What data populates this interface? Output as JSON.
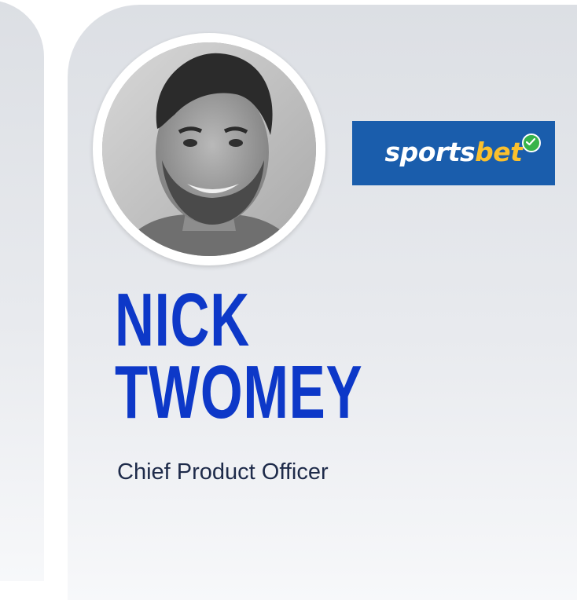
{
  "speaker": {
    "first_name": "NICK",
    "last_name": "TWOMEY",
    "role": "Chief Product Officer",
    "photo_description": "speaker-headshot"
  },
  "company": {
    "logo_part1": "sports",
    "logo_part2": "bet",
    "logo_background": "#1a5dac",
    "logo_accent": "#fbc02d",
    "logo_check_color": "#37b34a"
  },
  "theme": {
    "name_color": "#0d38c8",
    "role_color": "#1e2b4a",
    "card_top": "#dcdfe4",
    "card_bottom": "#f7f8fa"
  }
}
